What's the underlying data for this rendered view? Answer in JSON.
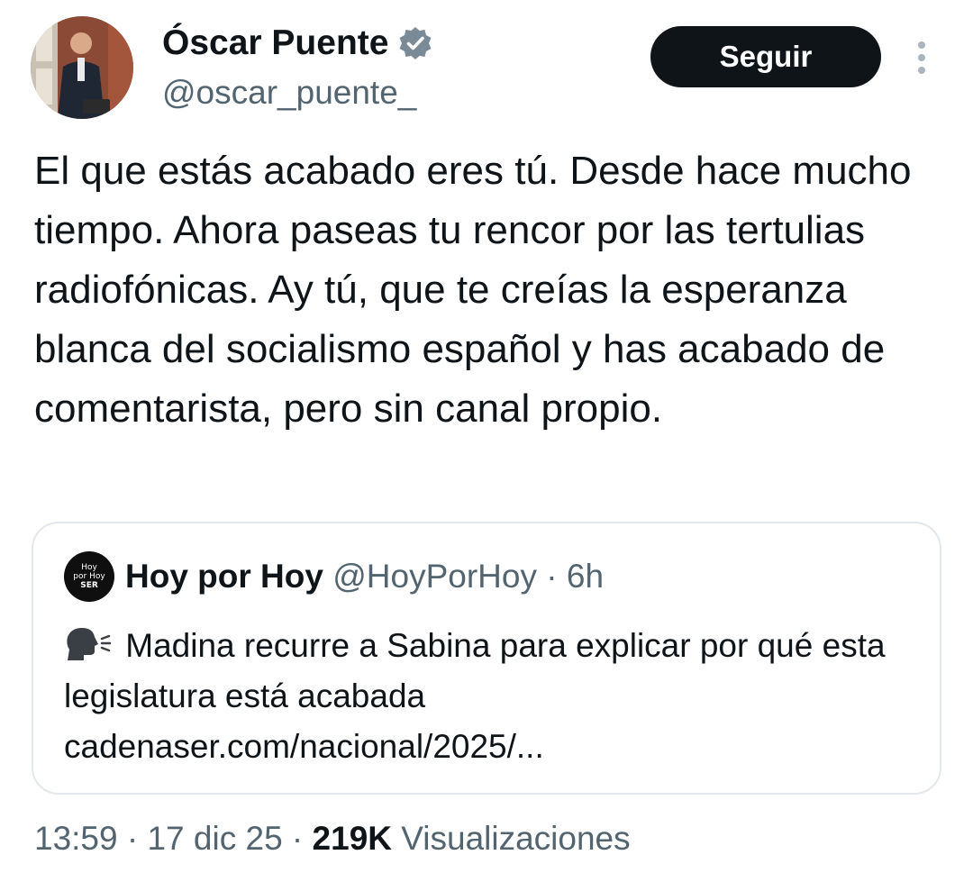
{
  "author": {
    "display_name": "Óscar Puente",
    "handle": "@oscar_puente_",
    "verified": true,
    "avatar_icon": "profile-photo"
  },
  "follow_button": {
    "label": "Seguir"
  },
  "more_icon": "vertical-ellipsis-icon",
  "tweet": {
    "text": "El que estás acabado eres tú. Desde hace mucho tiempo. Ahora paseas tu rencor por las tertulias radiofónicas. Ay tú, que te creías la esperanza blanca del socialismo español y has acabado de comentarista, pero sin canal propio."
  },
  "quote": {
    "avatar_lines": [
      "Hoy",
      "por Hoy",
      "SER"
    ],
    "name": "Hoy por Hoy",
    "handle": "@HoyPorHoy",
    "separator": " · ",
    "time": "6h",
    "text": "Madina recurre a Sabina para explicar por qué esta legislatura está acabada",
    "link": "cadenaser.com/nacional/2025/...",
    "leading_icon": "speaking-head-icon"
  },
  "footer": {
    "time": "13:59",
    "date": "17 dic 25",
    "views_count": "219K",
    "views_label": "Visualizaciones",
    "separator": " · "
  },
  "colors": {
    "text_primary": "#0f1419",
    "text_secondary": "#536471",
    "verified_badge": "#7b8a97",
    "button_bg": "#0f1419",
    "card_border": "#e3e6ea"
  }
}
